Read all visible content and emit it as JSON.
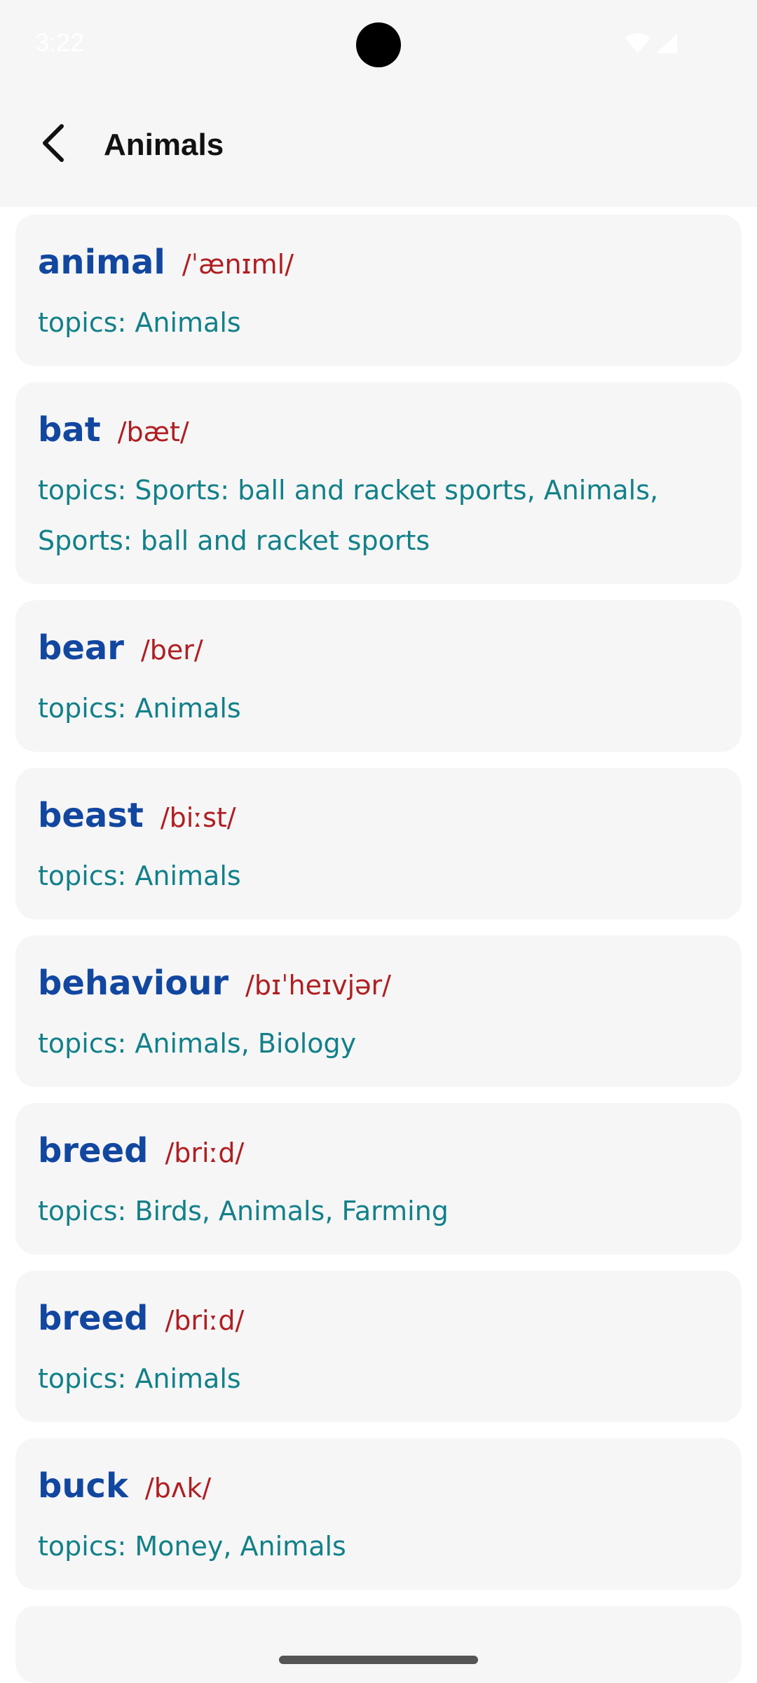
{
  "status_bar": {
    "time": "3:22",
    "wifi_icon": "wifi-icon",
    "signal_icon": "signal-icon"
  },
  "app_bar": {
    "back_icon": "chevron-left-icon",
    "title": "Animals"
  },
  "colors": {
    "word": "#1247a0",
    "phonetic": "#b01e22",
    "topics": "#128089",
    "card_bg": "#f6f6f6"
  },
  "entries": [
    {
      "word": "animal",
      "phonetic": "/ˈænɪml/",
      "topics": "topics: Animals"
    },
    {
      "word": "bat",
      "phonetic": "/bæt/",
      "topics": "topics: Sports: ball and racket sports, Animals, Sports: ball and racket sports"
    },
    {
      "word": "bear",
      "phonetic": "/ber/",
      "topics": "topics: Animals"
    },
    {
      "word": "beast",
      "phonetic": "/biːst/",
      "topics": "topics: Animals"
    },
    {
      "word": "behaviour",
      "phonetic": "/bɪˈheɪvjər/",
      "topics": "topics: Animals, Biology"
    },
    {
      "word": "breed",
      "phonetic": "/briːd/",
      "topics": "topics: Birds, Animals, Farming"
    },
    {
      "word": "breed",
      "phonetic": "/briːd/",
      "topics": "topics: Animals"
    },
    {
      "word": "buck",
      "phonetic": "/bʌk/",
      "topics": "topics: Money, Animals"
    }
  ]
}
